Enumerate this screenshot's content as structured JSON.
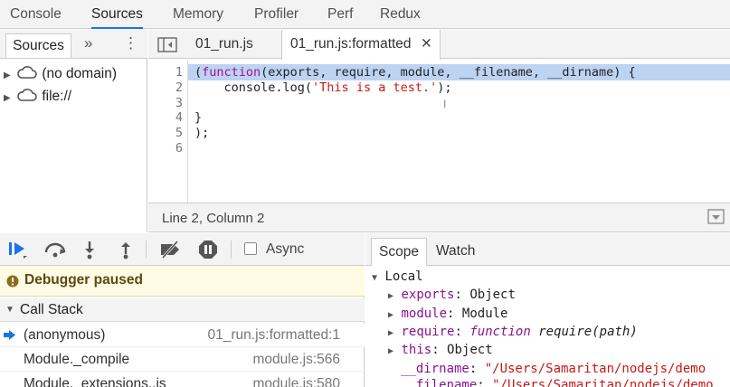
{
  "top_tabs": [
    {
      "label": "Console"
    },
    {
      "label": "Sources"
    },
    {
      "label": "Memory"
    },
    {
      "label": "Profiler"
    },
    {
      "label": "Perf"
    },
    {
      "label": "Redux"
    }
  ],
  "navigator": {
    "tab_label": "Sources",
    "more_glyph": "»",
    "menu_glyph": "⋮",
    "items": [
      {
        "label": "(no domain)"
      },
      {
        "label": "file://"
      }
    ]
  },
  "editor": {
    "tabs": [
      {
        "label": "01_run.js"
      },
      {
        "label": "01_run.js:formatted"
      }
    ],
    "close_glyph": "✕",
    "line_numbers": [
      "1",
      "2",
      "3",
      "4",
      "5",
      "6"
    ],
    "lines": {
      "l1": {
        "p1": "(",
        "kw": "function",
        "p2": "(exports, require, module, __filename, __dirname) {"
      },
      "l2": {
        "p1": "    console.log(",
        "str": "'This is a test.'",
        "p2": ");"
      },
      "l4": "}",
      "l5": ");"
    },
    "status": "Line 2, Column 2"
  },
  "debugger": {
    "async_label": "Async",
    "paused_label": "Debugger paused",
    "call_stack_label": "Call Stack",
    "frames": [
      {
        "name": "(anonymous)",
        "location": "01_run.js:formatted:1"
      },
      {
        "name": "Module._compile",
        "location": "module.js:566"
      },
      {
        "name": "Module._extensions..js",
        "location": "module.js:580"
      }
    ]
  },
  "scope": {
    "tabs": [
      {
        "label": "Scope"
      },
      {
        "label": "Watch"
      }
    ],
    "local_label": "Local",
    "props": [
      {
        "name": "exports",
        "value": "Object"
      },
      {
        "name": "module",
        "value": "Module"
      },
      {
        "name": "require",
        "kw": "function",
        "value": "require(path)"
      },
      {
        "name": "this",
        "value": "Object"
      },
      {
        "name": "__dirname",
        "value": "\"/Users/Samaritan/nodejs/demo"
      },
      {
        "name": "__filename",
        "value": "\"/Users/Samaritan/nodejs/demo"
      }
    ]
  },
  "colors": {
    "accent": "#1a73e8",
    "selection": "#bcd3f2",
    "paused_bg": "#fffbe5"
  }
}
